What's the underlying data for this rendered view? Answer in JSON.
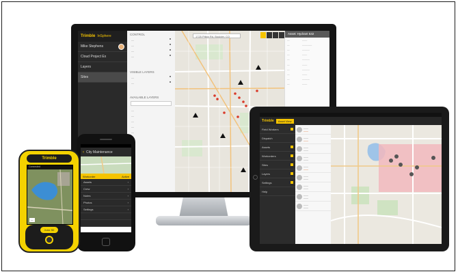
{
  "monitor": {
    "brand": "Trimble",
    "product": "InSphere",
    "nav": [
      "Mike Stephens",
      "Cloud Project Ex",
      "Layers",
      "Sites"
    ],
    "mid_sections": [
      "CONTROL",
      "VISIBLE LAYERS",
      "AVAILABLE LAYERS"
    ],
    "search_placeholder": "1725 Pitkin Rd, Boulder, CO",
    "right_header": "Asset: Hydrant 532"
  },
  "tablet": {
    "brand": "Trimble",
    "tab": "Asset View",
    "left_items": [
      "Field Workers",
      "Dispatch",
      "Assets",
      "Workorders",
      "Sites",
      "Layers",
      "Settings",
      "Help"
    ],
    "list_count": 9
  },
  "phone": {
    "title": "City Maintenance",
    "bar_left": "Workorder",
    "bar_right": "Active",
    "items": [
      "Assets",
      "Crew",
      "Notes",
      "Photos",
      "Settings"
    ]
  },
  "gps": {
    "brand": "Trimble",
    "button": "Juno 3D",
    "status": "Connected"
  },
  "colors": {
    "accent": "#f5c400",
    "dark": "#2a2a2a"
  }
}
